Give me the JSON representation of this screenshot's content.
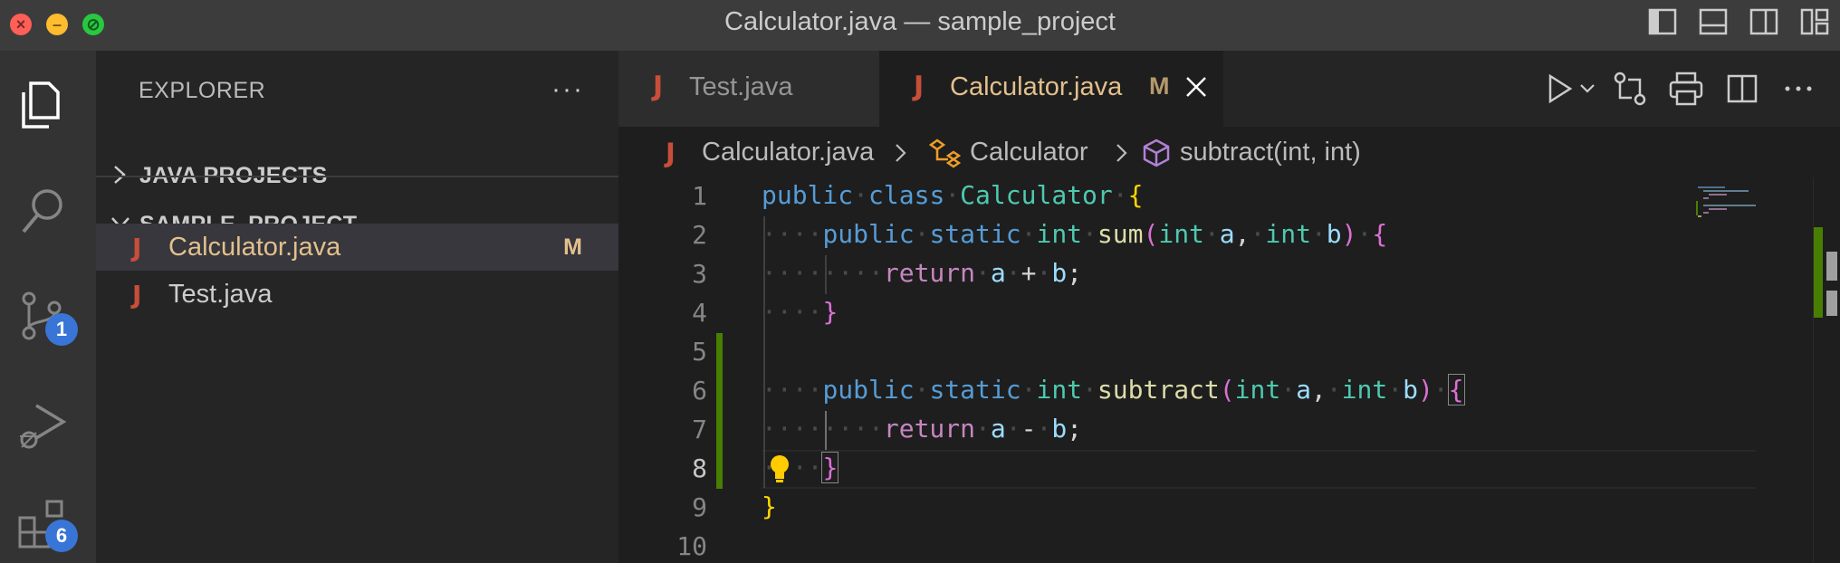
{
  "window": {
    "title": "Calculator.java — sample_project"
  },
  "activity_bar": {
    "source_control_badge": "1",
    "extensions_badge": "6"
  },
  "sidebar": {
    "header": "EXPLORER",
    "more": "···",
    "sections": [
      {
        "label": "JAVA PROJECTS",
        "expanded": false
      },
      {
        "label": "SAMPLE_PROJECT",
        "expanded": true
      }
    ],
    "files": [
      {
        "icon": "J",
        "name": "Calculator.java",
        "badge": "M",
        "active": true
      },
      {
        "icon": "J",
        "name": "Test.java",
        "badge": "",
        "active": false
      }
    ]
  },
  "tabs": [
    {
      "icon": "J",
      "label": "Test.java",
      "badge": ""
    },
    {
      "icon": "J",
      "label": "Calculator.java",
      "badge": "M"
    }
  ],
  "breadcrumb": {
    "file": "Calculator.java",
    "class": "Calculator",
    "method": "subtract(int, int)"
  },
  "code": {
    "line_numbers": [
      "1",
      "2",
      "3",
      "4",
      "5",
      "6",
      "7",
      "8",
      "9",
      "10"
    ]
  },
  "colors": {
    "modified": "#e2c08d",
    "java_icon": "#c74e39",
    "badge": "#3875d7",
    "gutter_added": "#487e02"
  }
}
